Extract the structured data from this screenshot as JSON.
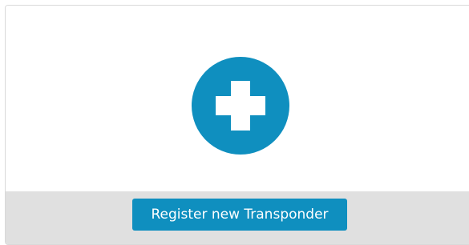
{
  "card": {
    "add_icon": "plus-icon",
    "register_button_label": "Register new Transponder"
  },
  "colors": {
    "accent": "#0f8fbf",
    "footer_background": "#e0e0e0",
    "card_border": "#d9d9d9"
  }
}
